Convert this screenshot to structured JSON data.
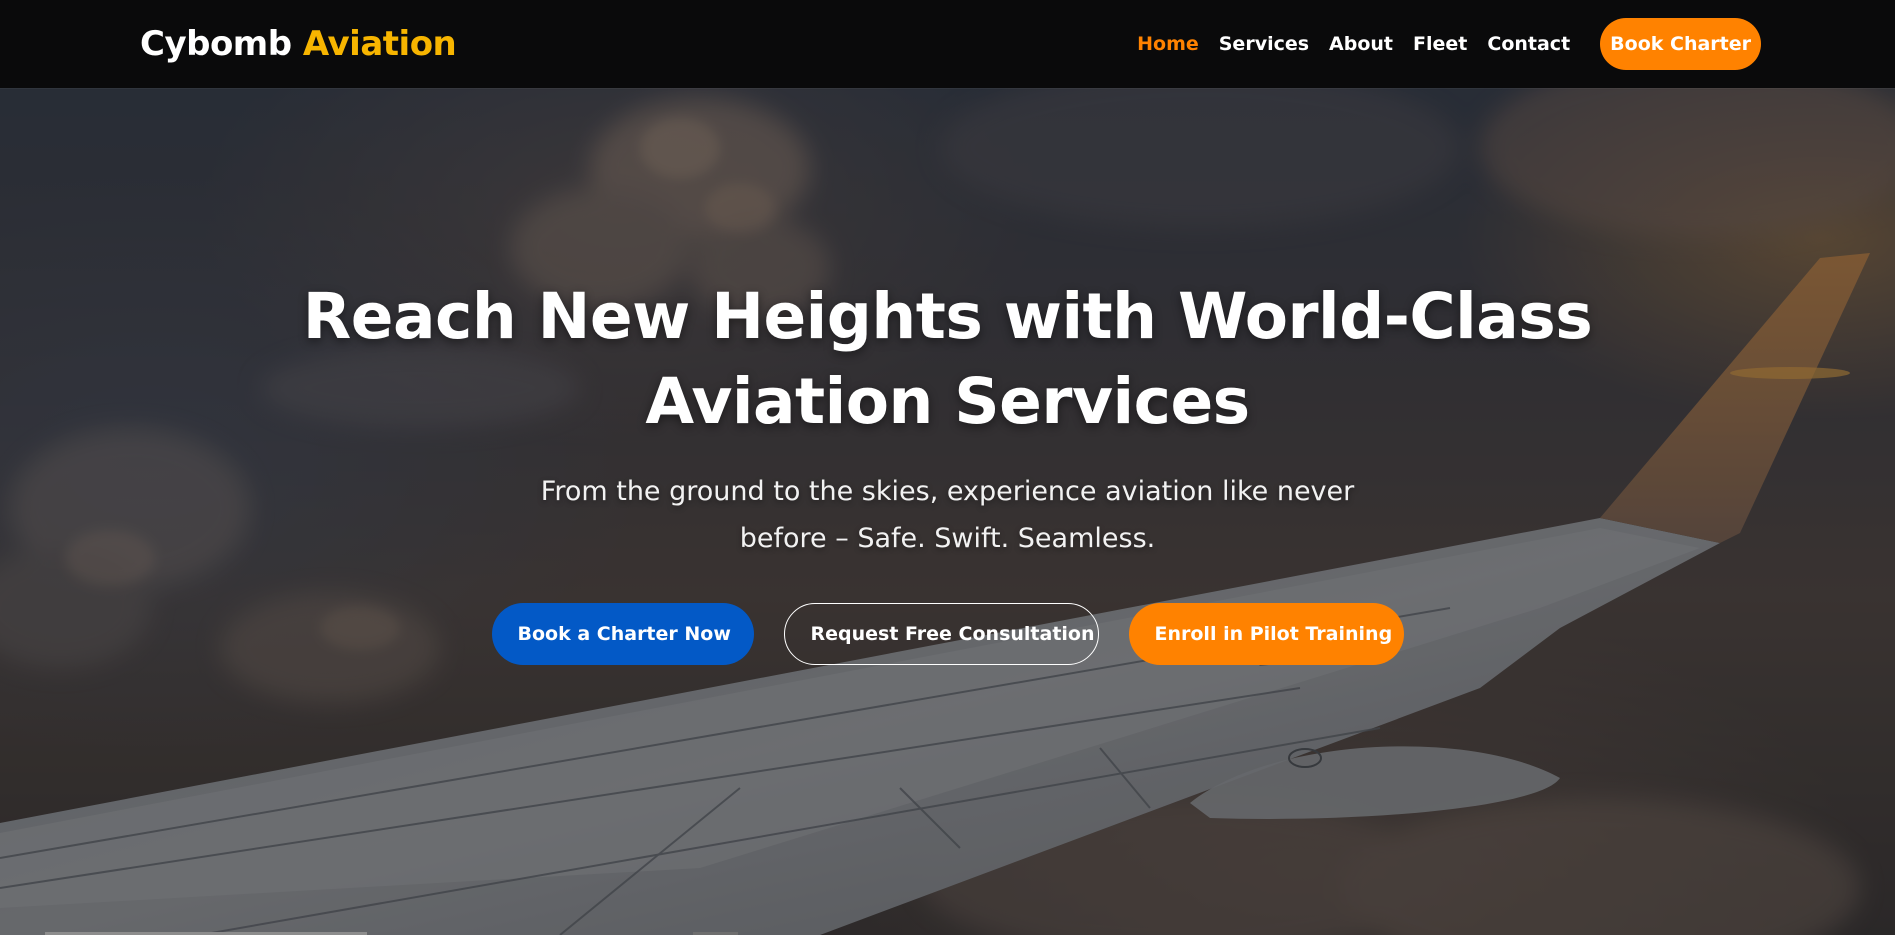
{
  "brand": {
    "name": "Cybomb",
    "accent": "Aviation"
  },
  "nav": {
    "links": [
      "Home",
      "Services",
      "About",
      "Fleet",
      "Contact"
    ],
    "active": "Home",
    "cta": "Book Charter"
  },
  "hero": {
    "title": "Reach New Heights with World-Class Aviation Services",
    "subtitle": "From the ground to the skies, experience aviation like never before – Safe. Swift. Seamless.",
    "buttons": {
      "primary": "Book a Charter Now",
      "secondary": "Request Free Consultation",
      "tertiary": "Enroll in Pilot Training"
    }
  },
  "colors": {
    "accent_orange": "#ff8200",
    "logo_accent": "#f7b500",
    "primary_blue": "#0359c6",
    "nav_bg": "#0a0a0b"
  },
  "icons": {
    "background_image": "airplane-wing-above-clouds"
  }
}
